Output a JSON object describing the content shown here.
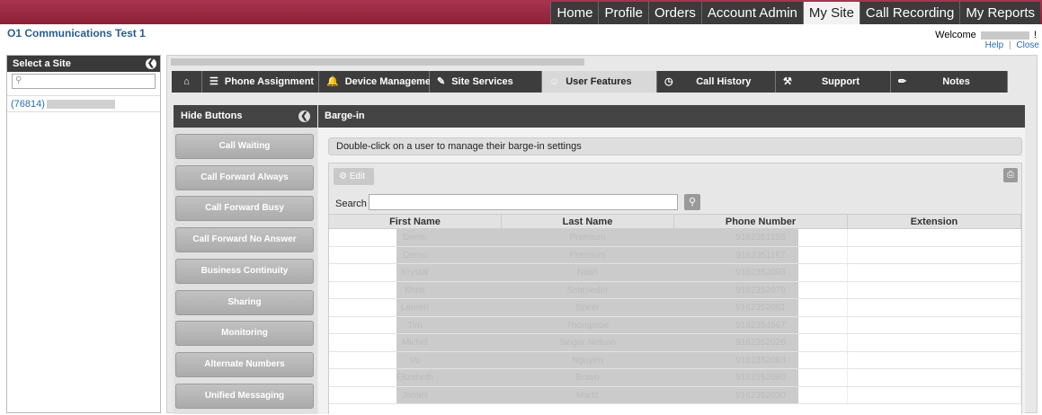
{
  "topnav": [
    "Home",
    "Profile",
    "Orders",
    "Account Admin",
    "My Site",
    "Call Recording",
    "My Reports"
  ],
  "topnav_active": "My Site",
  "company": "O1 Communications Test 1",
  "welcome": {
    "prefix": "Welcome",
    "suffix": "!"
  },
  "help_links": {
    "help": "Help",
    "sep": "|",
    "close": "Close"
  },
  "site_panel": {
    "title": "Select a Site",
    "search_placeholder": "",
    "site_id": "(76814)"
  },
  "tabs": [
    {
      "label": "Phone Assignment",
      "icon": "list-icon"
    },
    {
      "label": "Device Management",
      "icon": "bell-icon"
    },
    {
      "label": "Site Services",
      "icon": "edit-icon"
    },
    {
      "label": "User Features",
      "icon": "user-icon"
    },
    {
      "label": "Call History",
      "icon": "clock-icon"
    },
    {
      "label": "Support",
      "icon": "wrench-icon"
    },
    {
      "label": "Notes",
      "icon": "pencil-icon"
    }
  ],
  "active_tab": "User Features",
  "feature_panel": {
    "title": "Hide Buttons",
    "buttons": [
      "Call Waiting",
      "Call Forward Always",
      "Call Forward Busy",
      "Call Forward No Answer",
      "Business Continuity",
      "Sharing",
      "Monitoring",
      "Alternate Numbers",
      "Unified Messaging"
    ]
  },
  "content": {
    "title": "Barge-in",
    "info": "Double-click on a user to manage their barge-in settings",
    "edit_label": "Edit",
    "search_label": "Search",
    "search_value": ""
  },
  "grid": {
    "columns": [
      "First Name",
      "Last Name",
      "Phone Number",
      "Extension"
    ],
    "rows": [
      [
        "Demo",
        "Premium",
        "9162351155",
        ""
      ],
      [
        "Demo",
        "Premium",
        "9162351167",
        ""
      ],
      [
        "Krystal",
        "Nash",
        "9162352093",
        ""
      ],
      [
        "Khris",
        "Schroeder",
        "9162352079",
        ""
      ],
      [
        "Lauren",
        "Speer",
        "9162352081",
        ""
      ],
      [
        "Tim",
        "Thompson",
        "9162354567",
        ""
      ],
      [
        "Michel",
        "Singer Nelson",
        "9162352026",
        ""
      ],
      [
        "Vu",
        "Nguyen",
        "9162352083",
        ""
      ],
      [
        "Elizabeth",
        "Bravo",
        "9162352080",
        ""
      ],
      [
        "James",
        "Martz",
        "9162352030",
        ""
      ]
    ]
  },
  "colors": {
    "topbar": "#8d2138",
    "dark": "#3d3d3d",
    "link": "#2a6fb0"
  }
}
